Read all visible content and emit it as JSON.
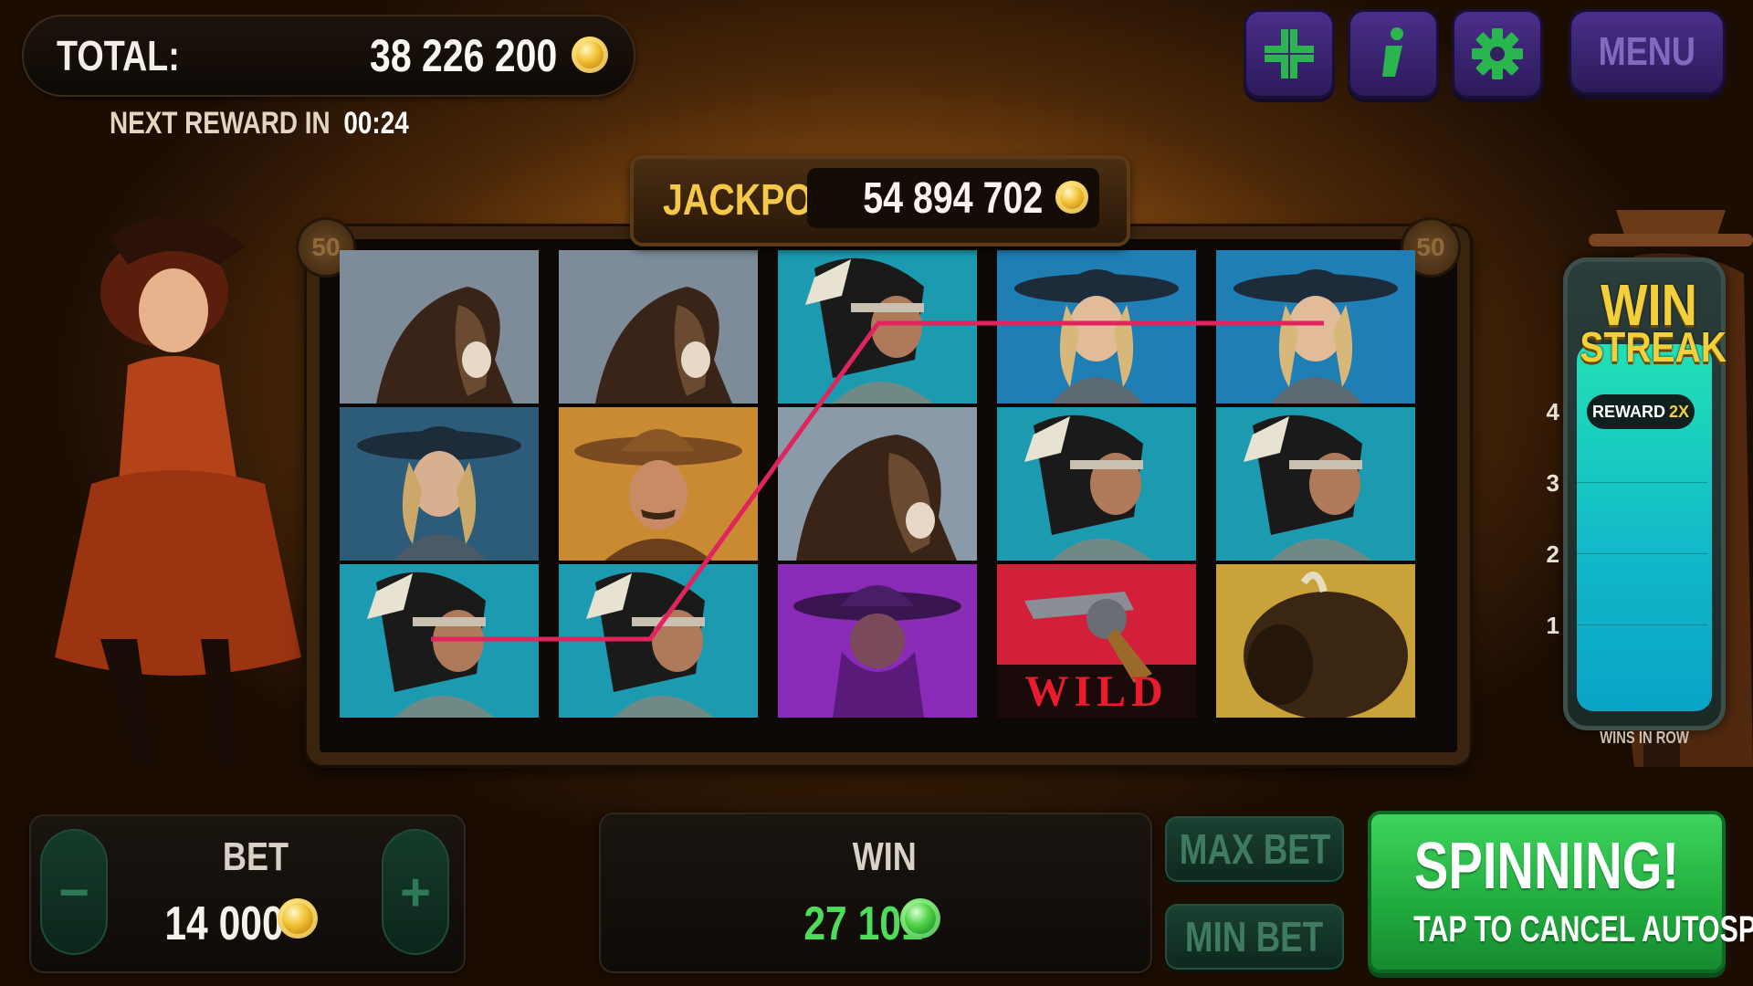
{
  "header": {
    "total_label": "TOTAL:",
    "total_value": "38 226 200",
    "next_reward_label": "NEXT REWARD IN",
    "next_reward_time": "00:24"
  },
  "toolbar": {
    "fullscreen_icon": "collapse-arrows-icon",
    "info_icon": "info-icon",
    "settings_icon": "gear-icon",
    "menu_label": "MENU"
  },
  "jackpot": {
    "label": "JACKPOT",
    "value": "54 894 702"
  },
  "paylines": {
    "left": "50",
    "right": "50",
    "line_color": "#e0245e"
  },
  "reels": [
    [
      "horse",
      "cowgirl",
      "native-woman"
    ],
    [
      "horse",
      "sheriff",
      "native-woman"
    ],
    [
      "native-woman",
      "horse",
      "masked-bandit"
    ],
    [
      "cowgirl",
      "native-woman",
      "wild-revolver"
    ],
    [
      "cowgirl",
      "native-woman",
      "bison"
    ]
  ],
  "wild_text": "WILD",
  "win_streak": {
    "title_line1": "WIN",
    "title_line2": "STREAK",
    "reward_label": "REWARD",
    "reward_multiplier": "2X",
    "levels": [
      "4",
      "3",
      "2",
      "1"
    ],
    "footer": "WINS IN ROW"
  },
  "bet": {
    "label": "BET",
    "value": "14 000",
    "minus": "−",
    "plus": "+"
  },
  "win": {
    "label": "WIN",
    "value": "27 101"
  },
  "buttons": {
    "max_bet": "MAX BET",
    "min_bet": "MIN BET",
    "spin_title": "SPINNING!",
    "spin_sub": "TAP TO CANCEL AUTOSPIN"
  }
}
